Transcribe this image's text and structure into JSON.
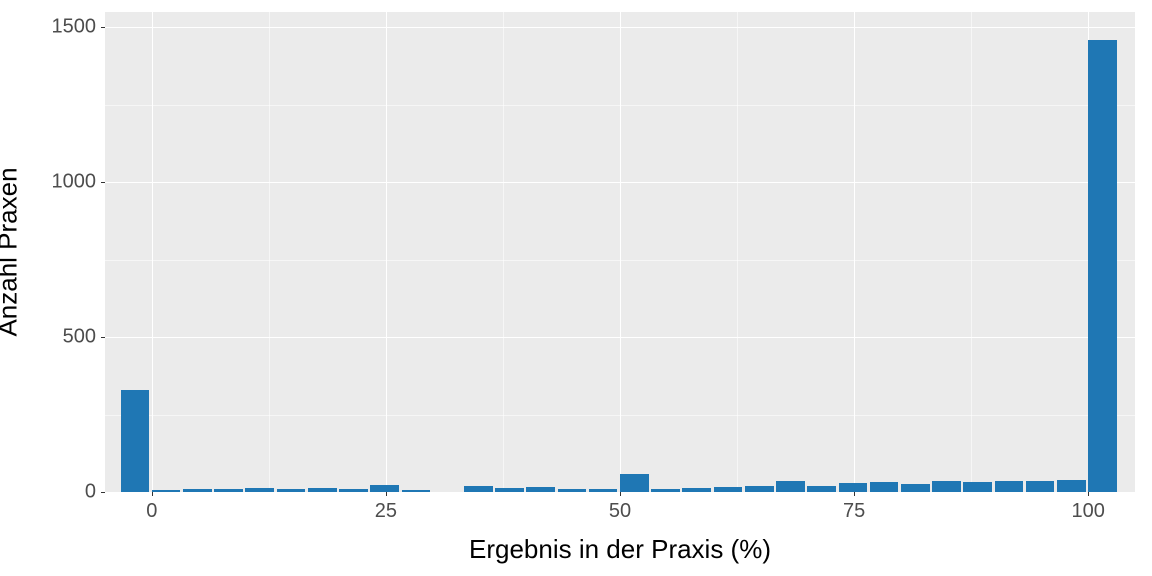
{
  "chart_data": {
    "type": "bar",
    "title": "",
    "xlabel": "Ergebnis in der Praxis (%)",
    "ylabel": "Anzahl Praxen",
    "xlim": [
      -5,
      105
    ],
    "ylim": [
      0,
      1550
    ],
    "x_ticks": [
      0,
      25,
      50,
      75,
      100
    ],
    "y_ticks": [
      0,
      500,
      1000,
      1500
    ],
    "x_minor": [
      12.5,
      37.5,
      62.5,
      87.5
    ],
    "y_minor": [
      250,
      750,
      1250
    ],
    "bin_width": 3.33,
    "bar_color": "#1f77b4",
    "bins": [
      {
        "x": 0.0,
        "count": 330
      },
      {
        "x": 3.33,
        "count": 8
      },
      {
        "x": 6.67,
        "count": 11
      },
      {
        "x": 10.0,
        "count": 11
      },
      {
        "x": 13.33,
        "count": 12
      },
      {
        "x": 16.67,
        "count": 11
      },
      {
        "x": 20.0,
        "count": 14
      },
      {
        "x": 23.33,
        "count": 11
      },
      {
        "x": 26.67,
        "count": 22
      },
      {
        "x": 30.0,
        "count": 7
      },
      {
        "x": 33.33,
        "count": 0
      },
      {
        "x": 36.67,
        "count": 20
      },
      {
        "x": 40.0,
        "count": 12
      },
      {
        "x": 43.33,
        "count": 15
      },
      {
        "x": 46.67,
        "count": 11
      },
      {
        "x": 50.0,
        "count": 9
      },
      {
        "x": 53.33,
        "count": 58
      },
      {
        "x": 56.67,
        "count": 10
      },
      {
        "x": 60.0,
        "count": 13
      },
      {
        "x": 63.33,
        "count": 15
      },
      {
        "x": 66.67,
        "count": 20
      },
      {
        "x": 70.0,
        "count": 36
      },
      {
        "x": 73.33,
        "count": 19
      },
      {
        "x": 76.67,
        "count": 28
      },
      {
        "x": 80.0,
        "count": 32
      },
      {
        "x": 83.33,
        "count": 26
      },
      {
        "x": 86.67,
        "count": 34
      },
      {
        "x": 90.0,
        "count": 32
      },
      {
        "x": 93.33,
        "count": 34
      },
      {
        "x": 96.67,
        "count": 36
      },
      {
        "x": 100.0,
        "count": 40
      },
      {
        "x": 103.33,
        "count": 1460
      }
    ]
  }
}
